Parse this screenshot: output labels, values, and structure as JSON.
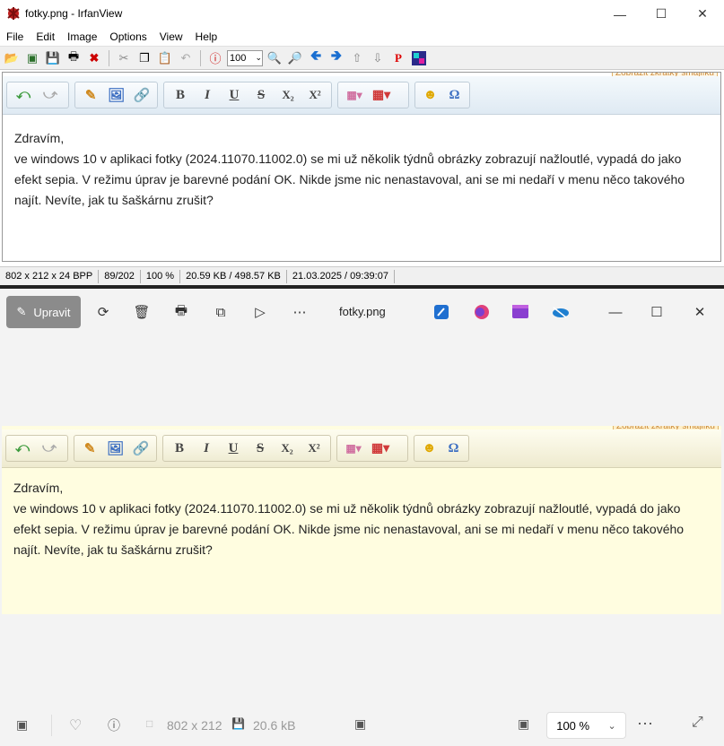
{
  "irfanview": {
    "title": "fotky.png - IrfanView",
    "menu": [
      "File",
      "Edit",
      "Image",
      "Options",
      "View",
      "Help"
    ],
    "zoom_value": "100",
    "status": {
      "dimensions": "802 x 212 x 24 BPP",
      "index": "89/202",
      "zoom": "100 %",
      "size": "20.59 KB / 498.57 KB",
      "datetime": "21.03.2025 / 09:39:07"
    }
  },
  "editor": {
    "link_text": "Zobrazit zkratky smajlíků",
    "greeting": "Zdravím,",
    "line1": "ve windows 10 v aplikaci fotky (2024.11070.11002.0) se mi už několik týdnů obrázky zobrazují nažloutlé, vypadá do jako",
    "line2": "efekt sepia. V režimu úprav je barevné podání OK. Nikde jsme nic nenastavoval, ani se mi nedaří v menu něco takového",
    "line3": "najít. Nevíte, jak tu šaškárnu zrušit?"
  },
  "photos": {
    "edit_label": "Upravit",
    "filename": "fotky.png",
    "dimensions": "802 x 212",
    "file_size": "20.6 kB",
    "zoom": "100 %"
  },
  "colors": {
    "photos_tint": "#fffde0",
    "irfan_bg": "#ffffff"
  }
}
